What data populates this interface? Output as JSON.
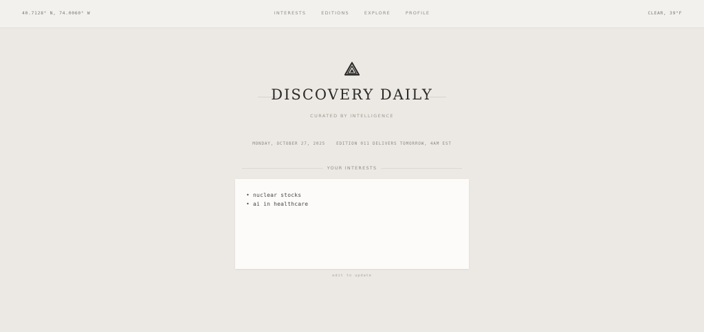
{
  "header": {
    "coordinates": "40.7128° N, 74.0060° W",
    "nav": [
      "INTERESTS",
      "EDITIONS",
      "EXPLORE",
      "PROFILE"
    ],
    "weather": "CLEAR, 39°F"
  },
  "brand": {
    "logo_icon": "triangle-loop-icon",
    "title": "DISCOVERY DAILY",
    "subtitle": "CURATED BY INTELLIGENCE"
  },
  "meta": {
    "date": "MONDAY, OCTOBER 27, 2025",
    "edition": "EDITION 011 DELIVERS TOMORROW, 4AM EST"
  },
  "interests": {
    "label": "YOUR INTERESTS",
    "items": [
      "• nuclear stocks",
      "• ai in healthcare"
    ],
    "hint": "edit to update"
  },
  "colors": {
    "background": "#ece9e4",
    "card": "#fcfbf9",
    "title": "#2b2a28"
  }
}
